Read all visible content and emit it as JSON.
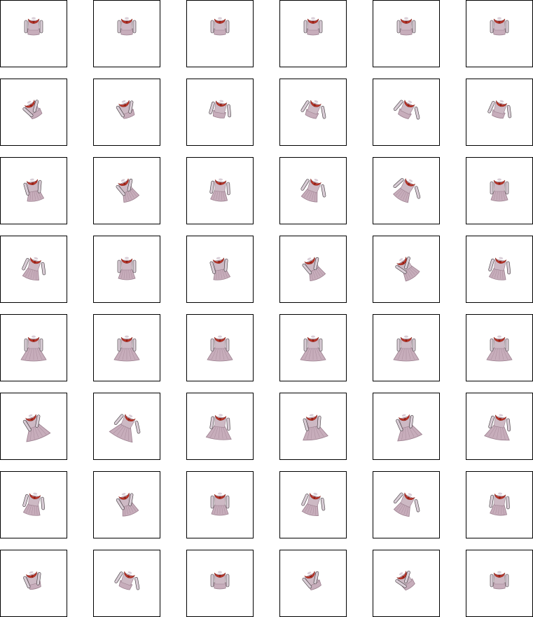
{
  "sprite_sheet": {
    "columns": 6,
    "rows": 8,
    "background": "#ffffff",
    "frame_border_color": "#000000",
    "colors": {
      "sleeve": "#d9cdd6",
      "sleeve_shadow": "#3a3236",
      "collar": "#c0392b",
      "collar_dark": "#8e1f16",
      "bodice": "#cdb9c4",
      "skirt": "#c7adbb",
      "skirt_shade": "#9b7f8e"
    },
    "rows_data": [
      {
        "pose": "front-neutral",
        "rotations": [
          0,
          0,
          0,
          0,
          0,
          0
        ],
        "skirt": 0
      },
      {
        "pose": "turning-arm-raised",
        "rotations": [
          -30,
          -20,
          10,
          20,
          25,
          15
        ],
        "skirt": 0
      },
      {
        "pose": "side-step",
        "rotations": [
          -10,
          -25,
          5,
          20,
          30,
          0
        ],
        "skirt": 1
      },
      {
        "pose": "side-walk",
        "rotations": [
          15,
          0,
          -10,
          -25,
          -35,
          10
        ],
        "skirt": 1
      },
      {
        "pose": "front-dress",
        "rotations": [
          0,
          0,
          0,
          0,
          0,
          0
        ],
        "skirt": 2
      },
      {
        "pose": "dress-turn",
        "rotations": [
          -20,
          25,
          5,
          -10,
          -15,
          10
        ],
        "skirt": 2
      },
      {
        "pose": "dress-side",
        "rotations": [
          10,
          -20,
          0,
          15,
          25,
          5
        ],
        "skirt": 1
      },
      {
        "pose": "low-angle",
        "rotations": [
          -15,
          20,
          0,
          -25,
          -35,
          0
        ],
        "skirt": 0
      }
    ]
  }
}
